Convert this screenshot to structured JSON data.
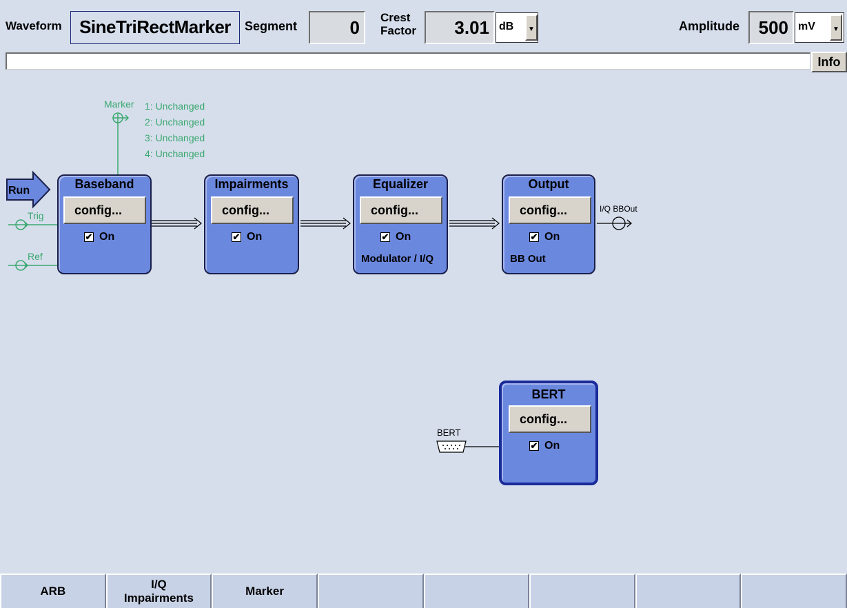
{
  "header": {
    "waveform_label": "Waveform",
    "waveform_value": "SineTriRectMarker",
    "segment_label": "Segment",
    "segment_value": "0",
    "crest_label_line1": "Crest",
    "crest_label_line2": "Factor",
    "crest_value": "3.01",
    "crest_unit": "dB",
    "amplitude_label": "Amplitude",
    "amplitude_value": "500",
    "amplitude_unit": "mV",
    "info_button": "Info"
  },
  "marker": {
    "label": "Marker",
    "lines": [
      "1: Unchanged",
      "2: Unchanged",
      "3: Unchanged",
      "4: Unchanged"
    ]
  },
  "inputs": {
    "run": "Run",
    "trig": "Trig",
    "ref": "Ref"
  },
  "blocks": {
    "baseband": {
      "title": "Baseband",
      "config": "config...",
      "on": "On"
    },
    "impairments": {
      "title": "Impairments",
      "config": "config...",
      "on": "On"
    },
    "equalizer": {
      "title": "Equalizer",
      "config": "config...",
      "on": "On",
      "sub": "Modulator / I/Q"
    },
    "output": {
      "title": "Output",
      "config": "config...",
      "on": "On",
      "sub": "BB Out"
    },
    "bert": {
      "title": "BERT",
      "config": "config...",
      "on": "On"
    }
  },
  "connectors": {
    "iq_bbout": "I/Q BBOut",
    "bert": "BERT"
  },
  "softkeys": [
    {
      "line1": "ARB",
      "line2": ""
    },
    {
      "line1": "I/Q",
      "line2": "Impairments"
    },
    {
      "line1": "Marker",
      "line2": ""
    },
    {
      "line1": "",
      "line2": ""
    },
    {
      "line1": "",
      "line2": ""
    },
    {
      "line1": "",
      "line2": ""
    },
    {
      "line1": "",
      "line2": ""
    },
    {
      "line1": "",
      "line2": ""
    }
  ],
  "colors": {
    "background": "#d6deec",
    "block_fill": "#6b88df",
    "marker_green": "#3aa86e"
  }
}
